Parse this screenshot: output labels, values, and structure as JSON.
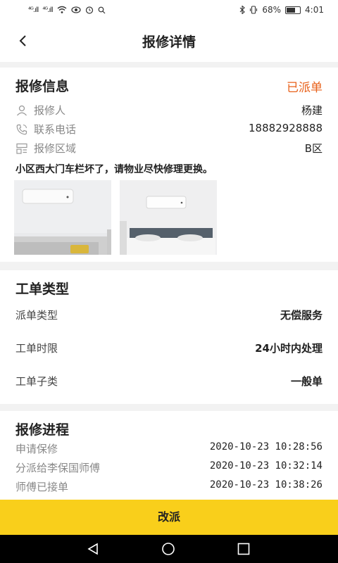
{
  "status_bar": {
    "signal1": "⁴ᴳ.ıll",
    "signal2": "⁴ᴳ.ıll",
    "battery_text": "68%",
    "battery_level": 0.68,
    "time": "4:01"
  },
  "header": {
    "title": "报修详情"
  },
  "repair_info": {
    "title": "报修信息",
    "status": "已派单",
    "fields": [
      {
        "icon": "person-icon",
        "label": "报修人",
        "value": "杨建"
      },
      {
        "icon": "phone-icon",
        "label": "联系电话",
        "value": "18882928888"
      },
      {
        "icon": "area-icon",
        "label": "报修区域",
        "value": "B区"
      }
    ],
    "description": "小区西大门车栏坏了，请物业尽快修理更换。"
  },
  "order_type": {
    "title": "工单类型",
    "rows": [
      {
        "label": "派单类型",
        "value": "无偿服务"
      },
      {
        "label": "工单时限",
        "value": "24小时内处理"
      },
      {
        "label": "工单子类",
        "value": "一般单"
      }
    ]
  },
  "progress": {
    "title": "报修进程",
    "rows": [
      {
        "label": "申请保修",
        "time": "2020-10-23 10:28:56"
      },
      {
        "label": "分派给李保国师傅",
        "time": "2020-10-23 10:32:14"
      },
      {
        "label": "师傅已接单",
        "time": "2020-10-23 10:38:26"
      }
    ]
  },
  "action": {
    "label": "改派"
  },
  "colors": {
    "accent": "#f9cf1b",
    "status": "#e8611a"
  }
}
